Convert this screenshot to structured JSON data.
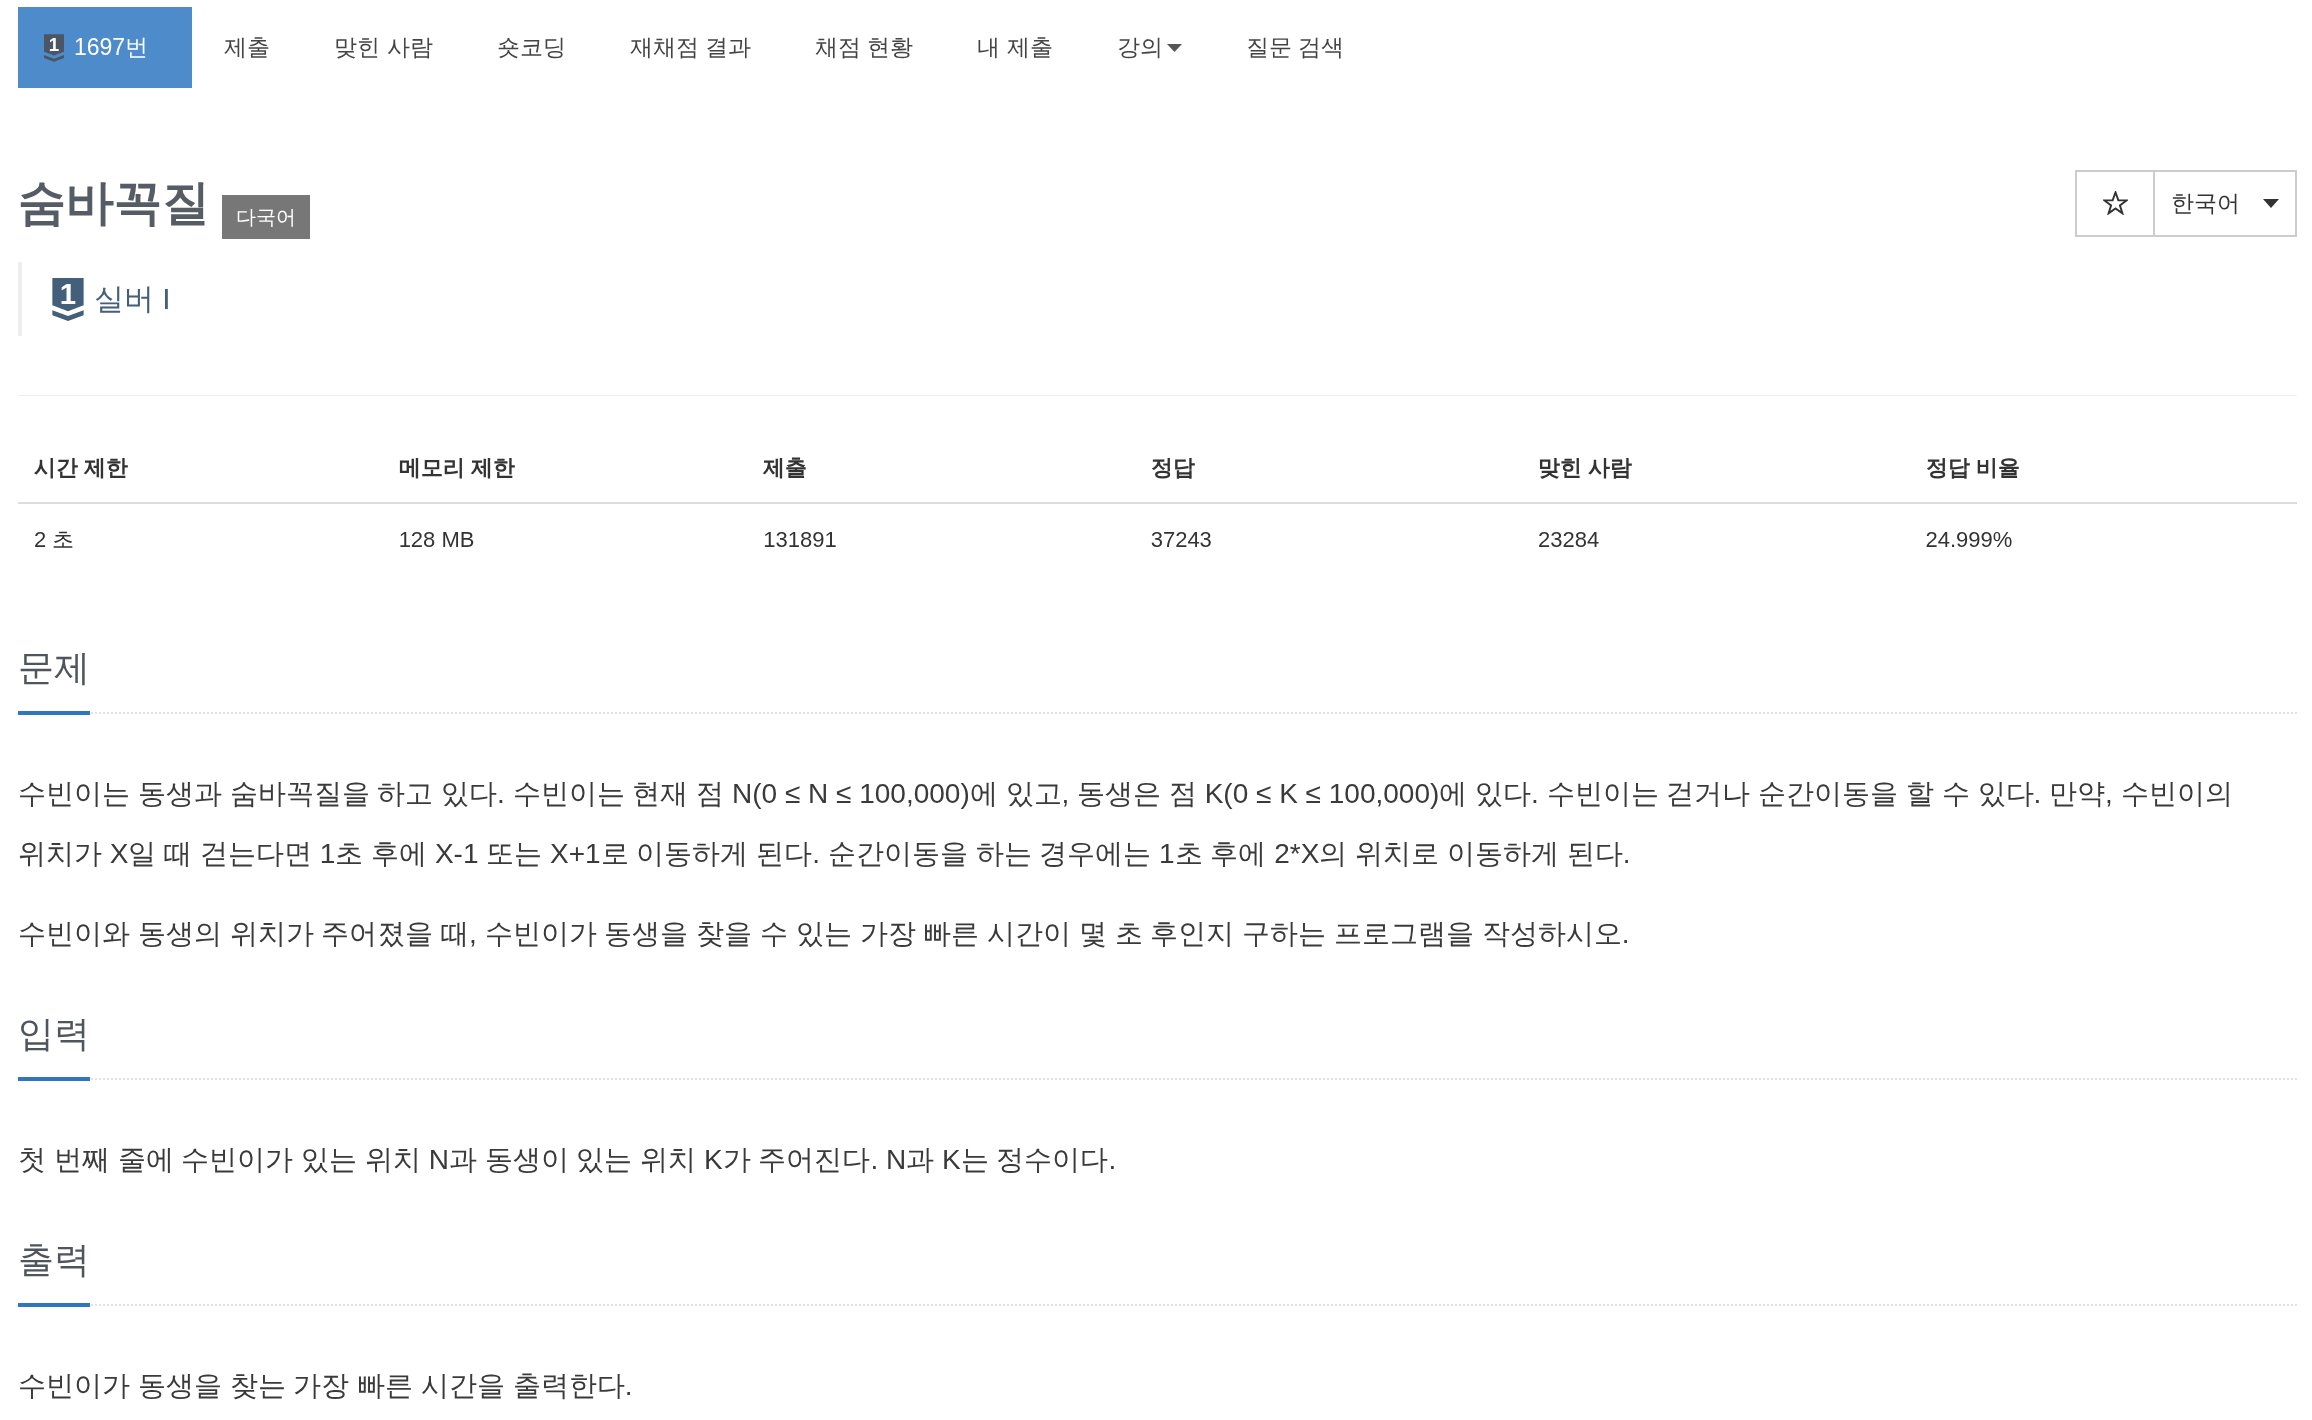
{
  "nav": {
    "tabs": [
      {
        "label": "1697번",
        "badge": "1",
        "selected": true,
        "has_menu": false
      },
      {
        "label": "제출",
        "selected": false,
        "has_menu": false
      },
      {
        "label": "맞힌 사람",
        "selected": false,
        "has_menu": false
      },
      {
        "label": "숏코딩",
        "selected": false,
        "has_menu": false
      },
      {
        "label": "재채점 결과",
        "selected": false,
        "has_menu": false
      },
      {
        "label": "채점 현황",
        "selected": false,
        "has_menu": false
      },
      {
        "label": "내 제출",
        "selected": false,
        "has_menu": false
      },
      {
        "label": "강의",
        "selected": false,
        "has_menu": true
      },
      {
        "label": "질문 검색",
        "selected": false,
        "has_menu": false
      }
    ]
  },
  "header": {
    "title": "숨바꼭질",
    "tag": "다국어",
    "tier": {
      "badge": "1",
      "label": "실버 I"
    },
    "starred": false,
    "language": "한국어"
  },
  "info_table": {
    "columns": [
      "시간 제한",
      "메모리 제한",
      "제출",
      "정답",
      "맞힌 사람",
      "정답 비율"
    ],
    "rows": [
      [
        "2 초",
        "128 MB",
        "131891",
        "37243",
        "23284",
        "24.999%"
      ]
    ]
  },
  "sections": [
    {
      "heading": "문제",
      "paragraphs": [
        "수빈이는 동생과 숨바꼭질을 하고 있다. 수빈이는 현재 점 N(0 ≤ N ≤ 100,000)에 있고, 동생은 점 K(0 ≤ K ≤ 100,000)에 있다. 수빈이는 걷거나 순간이동을 할 수 있다. 만약, 수빈이의 위치가 X일 때 걷는다면 1초 후에 X-1 또는 X+1로 이동하게 된다. 순간이동을 하는 경우에는 1초 후에 2*X의 위치로 이동하게 된다.",
        "수빈이와 동생의 위치가 주어졌을 때, 수빈이가 동생을 찾을 수 있는 가장 빠른 시간이 몇 초 후인지 구하는 프로그램을 작성하시오."
      ]
    },
    {
      "heading": "입력",
      "paragraphs": [
        "첫 번째 줄에 수빈이가 있는 위치 N과 동생이 있는 위치 K가 주어진다. N과 K는 정수이다."
      ]
    },
    {
      "heading": "출력",
      "paragraphs": [
        "수빈이가 동생을 찾는 가장 빠른 시간을 출력한다."
      ]
    }
  ]
}
